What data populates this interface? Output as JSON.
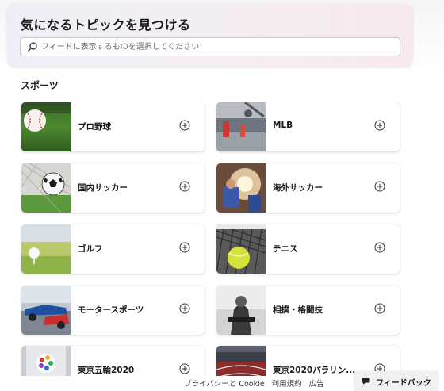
{
  "header": {
    "title": "気になるトピックを見つける",
    "search_placeholder": "フィードに表示するものを選択してください"
  },
  "section": {
    "title": "スポーツ"
  },
  "topics": [
    {
      "label": "プロ野球",
      "thumb_icon": "baseball-icon"
    },
    {
      "label": "MLB",
      "thumb_icon": "stadium-icon"
    },
    {
      "label": "国内サッカー",
      "thumb_icon": "soccer-ball-icon"
    },
    {
      "label": "海外サッカー",
      "thumb_icon": "soccer-player-icon"
    },
    {
      "label": "ゴルフ",
      "thumb_icon": "golf-ball-icon"
    },
    {
      "label": "テニス",
      "thumb_icon": "tennis-ball-icon"
    },
    {
      "label": "モータースポーツ",
      "thumb_icon": "race-car-icon"
    },
    {
      "label": "相撲・格闘技",
      "thumb_icon": "fighter-icon"
    },
    {
      "label": "東京五輪2020",
      "thumb_icon": "olympic-emblem-icon"
    },
    {
      "label": "東京2020パラリン...",
      "thumb_icon": "paralympic-track-icon"
    }
  ],
  "footer": {
    "privacy": "プライバシーと Cookie",
    "terms": "利用規約",
    "ads": "広告",
    "feedback": "フィードバック"
  },
  "colors": {
    "header_gradient_start": "#efeef6",
    "header_gradient_end": "#f8e9ee",
    "tile_background": "#ffffff",
    "text": "#1b1b1b"
  }
}
